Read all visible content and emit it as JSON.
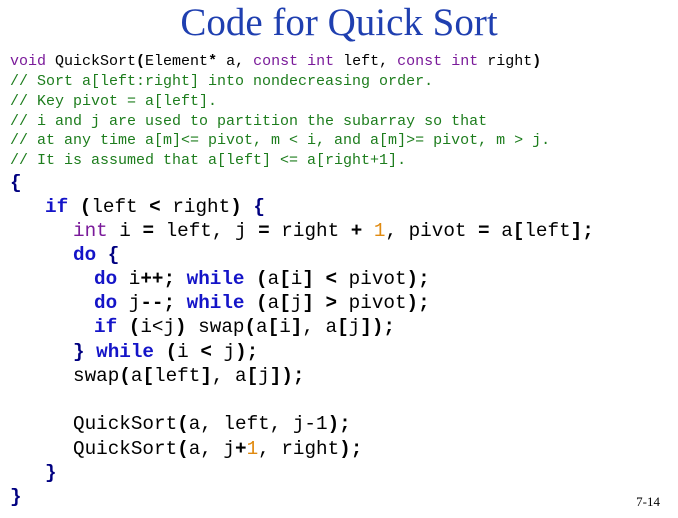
{
  "title": "Code for Quick Sort",
  "page_number": "7-14",
  "signature": {
    "kw_void": "void",
    "name": " QuickSort",
    "paren_open": "(",
    "param1_type": "Element",
    "star": "*",
    "param1_name": " a, ",
    "const1": "const",
    "sp1": " ",
    "int1": "int",
    "param2_name": " left, ",
    "const2": "const",
    "sp2": " ",
    "int2": "int",
    "param3_name": " right",
    "paren_close": ")"
  },
  "comments": [
    "// Sort a[left:right] into nondecreasing order.",
    "// Key pivot = a[left].",
    "// i and j are used to partition the subarray so that",
    "// at any time a[m]<= pivot, m < i, and a[m]>= pivot, m > j.",
    "// It is assumed that a[left] <= a[right+1]."
  ],
  "body": {
    "open_brace": "{",
    "if_kw": "if",
    "if_cond_open": " (",
    "if_left": "left ",
    "if_lt": "<",
    "if_right": " right",
    "if_cond_close": ")",
    "if_brace": " {",
    "int_kw": "int",
    "decl_i": " i ",
    "eq1": "=",
    "decl_left": " left, j ",
    "eq2": "=",
    "decl_right": " right ",
    "plus1": "+",
    "sp_one": " ",
    "one1": "1",
    "decl_pivot": ", pivot ",
    "eq3": "=",
    "decl_a": " a",
    "br_open1": "[",
    "decl_leftidx": "left",
    "br_close1": "]",
    "semi1": ";",
    "do_kw": "do",
    "do_brace": " {",
    "inc_do": "do",
    "inc_var": " i",
    "inc_op": "++",
    "inc_semi": "; ",
    "inc_while": "while",
    "inc_paren": " (",
    "inc_a": "a",
    "inc_br_o": "[",
    "inc_i": "i",
    "inc_br_c": "]",
    "inc_sp": " ",
    "inc_lt": "<",
    "inc_pivot": " pivot",
    "inc_close": ");",
    "dec_do": "do",
    "dec_var": " j",
    "dec_op": "--",
    "dec_semi": "; ",
    "dec_while": "while",
    "dec_paren": " (",
    "dec_a": "a",
    "dec_br_o": "[",
    "dec_j": "j",
    "dec_br_c": "]",
    "dec_sp": " ",
    "dec_gt": ">",
    "dec_pivot": " pivot",
    "dec_close": ");",
    "swap_if": "if",
    "swap_paren": " (",
    "swap_cond": "i<j",
    "swap_cparen": ")",
    "swap_call": " swap",
    "swap_p_o": "(",
    "swap_a1": "a",
    "swap_b1o": "[",
    "swap_i": "i",
    "swap_b1c": "]",
    "swap_mid": ", a",
    "swap_b2o": "[",
    "swap_j": "j",
    "swap_b2c": "]",
    "swap_end": ");",
    "do_close_brace": "}",
    "do_close_while": " while",
    "do_close_paren": " (",
    "do_close_cond_i": "i ",
    "do_close_lt": "<",
    "do_close_cond_j": " j",
    "do_close_end": ");",
    "swap2_name": "swap",
    "swap2_po": "(",
    "swap2_a": "a",
    "swap2_b1o": "[",
    "swap2_left": "left",
    "swap2_b1c": "]",
    "swap2_mid": ", a",
    "swap2_b2o": "[",
    "swap2_j": "j",
    "swap2_b2c": "]",
    "swap2_end": ");",
    "rec1_name": "QuickSort",
    "rec1_po": "(",
    "rec1_args": "a, left, j-1",
    "rec1_end": ");",
    "rec2_name": "QuickSort",
    "rec2_po": "(",
    "rec2_a": "a, j",
    "rec2_plus": "+",
    "rec2_one": "1",
    "rec2_rest": ", right",
    "rec2_end": ");",
    "inner_close": "}",
    "outer_close": "}"
  }
}
